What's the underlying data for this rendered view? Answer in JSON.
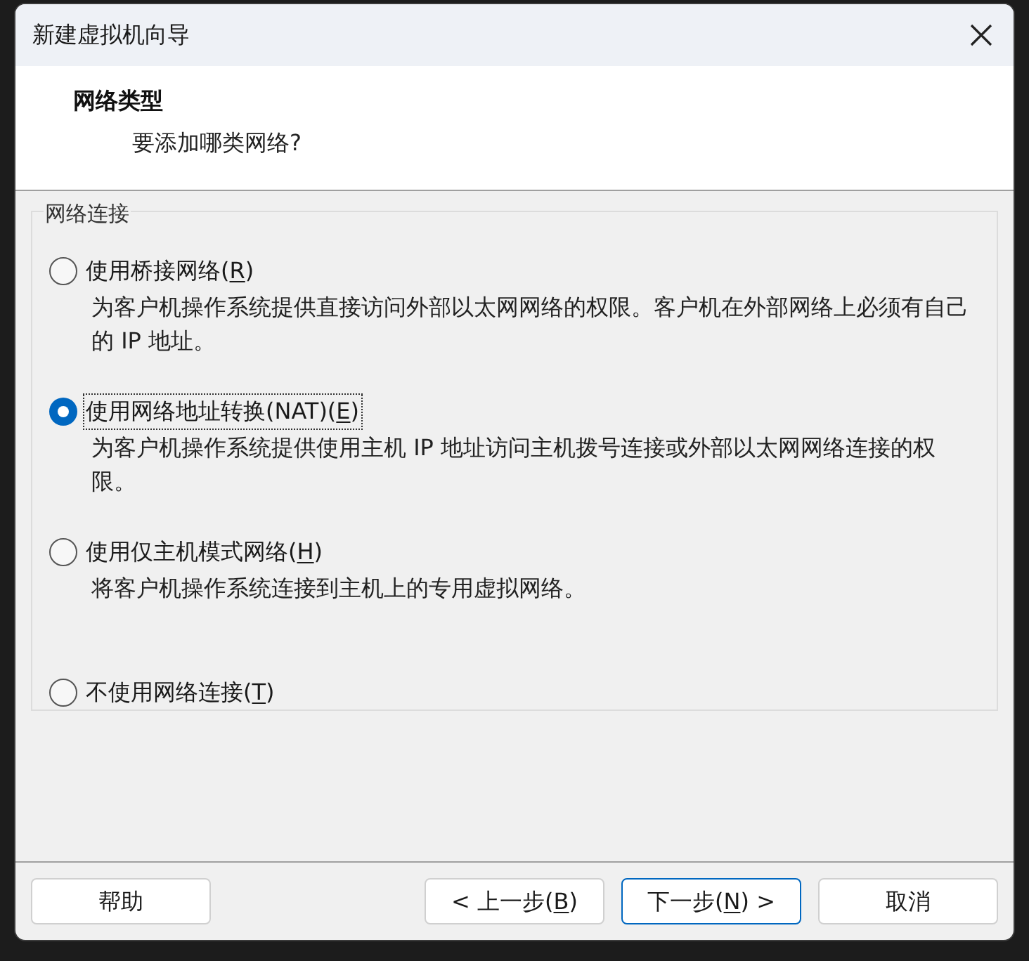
{
  "window": {
    "title": "新建虚拟机向导"
  },
  "header": {
    "title": "网络类型",
    "subtitle": "要添加哪类网络?"
  },
  "group": {
    "legend": "网络连接",
    "options": [
      {
        "before": "使用桥接网络(",
        "key": "R",
        "after": ")",
        "description": "为客户机操作系统提供直接访问外部以太网网络的权限。客户机在外部网络上必须有自己的 IP 地址。",
        "selected": false,
        "focused": false
      },
      {
        "before": "使用网络地址转换(NAT)(",
        "key": "E",
        "after": ")",
        "description": "为客户机操作系统提供使用主机 IP 地址访问主机拨号连接或外部以太网网络连接的权限。",
        "selected": true,
        "focused": true
      },
      {
        "before": "使用仅主机模式网络(",
        "key": "H",
        "after": ")",
        "description": "将客户机操作系统连接到主机上的专用虚拟网络。",
        "selected": false,
        "focused": false
      },
      {
        "before": "不使用网络连接(",
        "key": "T",
        "after": ")",
        "selected": false,
        "focused": false
      }
    ]
  },
  "left_buttons": [
    {
      "before": "帮助",
      "default": false
    }
  ],
  "right_buttons": [
    {
      "before": "< 上一步(",
      "key": "B",
      "after": ")",
      "default": false
    },
    {
      "before": "下一步(",
      "key": "N",
      "after": ") >",
      "default": true
    },
    {
      "before": "取消",
      "default": false
    }
  ]
}
